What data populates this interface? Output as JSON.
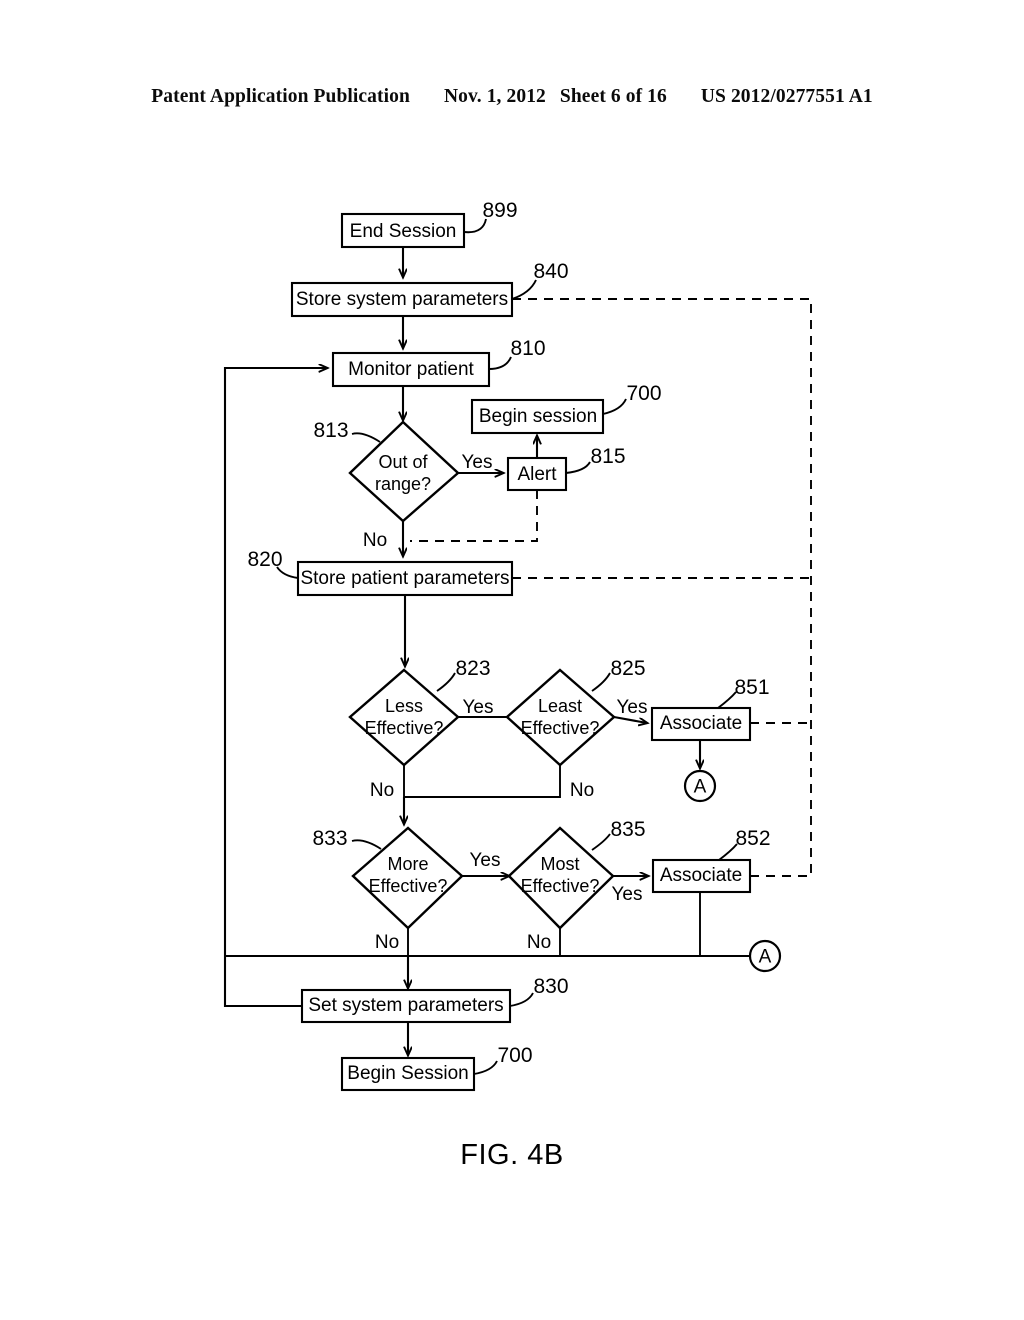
{
  "header": {
    "publication": "Patent Application Publication",
    "date": "Nov. 1, 2012",
    "sheet": "Sheet 6 of 16",
    "patent_number": "US 2012/0277551 A1"
  },
  "figure": {
    "caption": "FIG. 4B",
    "type": "flowchart"
  },
  "nodes": {
    "end_session": {
      "label": "End Session",
      "ref": "899",
      "shape": "box"
    },
    "store_system_parameters": {
      "label": "Store system parameters",
      "ref": "840",
      "shape": "box"
    },
    "monitor_patient": {
      "label": "Monitor patient",
      "ref": "810",
      "shape": "box"
    },
    "out_of_range": {
      "label_line1": "Out of",
      "label_line2": "range?",
      "ref": "813",
      "shape": "diamond"
    },
    "begin_session_top": {
      "label": "Begin session",
      "ref": "700",
      "shape": "box"
    },
    "alert": {
      "label": "Alert",
      "ref": "815",
      "shape": "box"
    },
    "store_patient_parameters": {
      "label": "Store patient parameters",
      "ref": "820",
      "shape": "box"
    },
    "less_effective": {
      "label_line1": "Less",
      "label_line2": "Effective?",
      "ref": "823",
      "shape": "diamond"
    },
    "least_effective": {
      "label_line1": "Least",
      "label_line2": "Effective?",
      "ref": "825",
      "shape": "diamond"
    },
    "associate_851": {
      "label": "Associate",
      "ref": "851",
      "shape": "box"
    },
    "more_effective": {
      "label_line1": "More",
      "label_line2": "Effective?",
      "ref": "833",
      "shape": "diamond"
    },
    "most_effective": {
      "label_line1": "Most",
      "label_line2": "Effective?",
      "ref": "835",
      "shape": "diamond"
    },
    "associate_852": {
      "label": "Associate",
      "ref": "852",
      "shape": "box"
    },
    "set_system_parameters": {
      "label": "Set system parameters",
      "ref": "830",
      "shape": "box"
    },
    "begin_session_bottom": {
      "label": "Begin Session",
      "ref": "700",
      "shape": "box"
    },
    "connector_a_upper": {
      "label": "A",
      "shape": "circle"
    },
    "connector_a_lower": {
      "label": "A",
      "shape": "circle"
    }
  },
  "edge_labels": {
    "out_of_range_yes": "Yes",
    "out_of_range_no": "No",
    "less_effective_yes": "Yes",
    "less_effective_no": "No",
    "least_effective_yes": "Yes",
    "least_effective_no": "No",
    "more_effective_yes": "Yes",
    "more_effective_no": "No",
    "most_effective_yes": "Yes",
    "most_effective_no": "No"
  },
  "colors": {
    "ink": "#000000",
    "paper": "#ffffff"
  }
}
